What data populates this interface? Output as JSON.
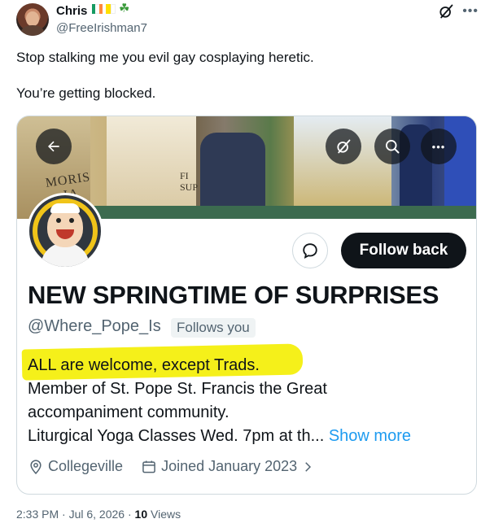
{
  "author": {
    "name": "Chris",
    "handle": "@FreeIrishman7",
    "flags": [
      "irish-flag",
      "vatican-flag",
      "shamrock"
    ]
  },
  "post": {
    "lines": [
      "Stop stalking me you evil gay cosplaying heretic.",
      "You’re getting blocked."
    ],
    "timestamp": "2:33 PM · Jul 6, 2026 · ",
    "views_count": "10",
    "views_label": "Views"
  },
  "card": {
    "banner_sign_1": "MORIS\n    IA",
    "banner_sign_2": "FI\nSUP",
    "name": "NEW SPRINGTIME OF SURPRISES",
    "handle": "@Where_Pope_Is",
    "follows_you": "Follows you",
    "follow_button": "Follow back",
    "bio": [
      "ALL are welcome, except Trads.",
      "Member of St. Pope St. Francis the Great",
      "accompaniment community.",
      "Liturgical Yoga Classes Wed. 7pm at th..."
    ],
    "show_more": "Show more",
    "location": "Collegeville",
    "joined": "Joined January 2023",
    "highlight_color": "#f5f01a"
  },
  "colors": {
    "text": "#0f1419",
    "secondary": "#536471",
    "link": "#1d9bf0",
    "border": "#cfd9de"
  }
}
